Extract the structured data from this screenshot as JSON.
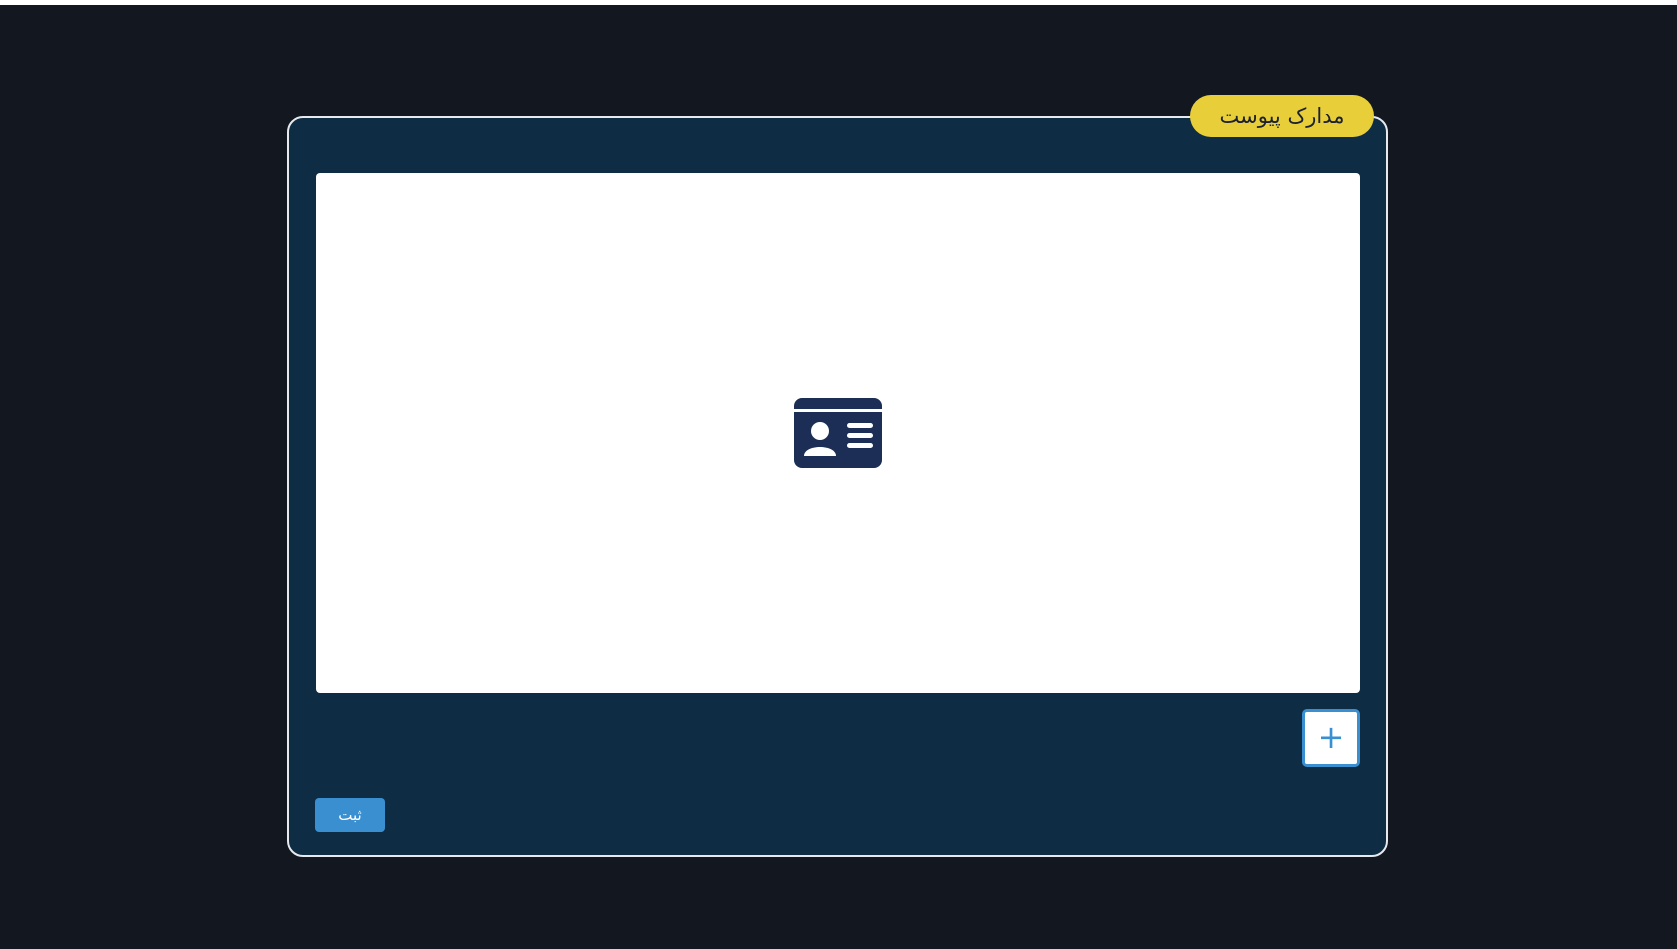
{
  "panel": {
    "title": "مدارک پیوست",
    "preview_icon": "id-card-icon",
    "add_icon": "plus-icon",
    "add_label": "+",
    "submit_label": "ثبت"
  },
  "colors": {
    "background": "#131720",
    "panel": "#0e2c44",
    "accent_yellow": "#e8cf3a",
    "accent_blue": "#3a8fd0",
    "icon_navy": "#1c2e55"
  }
}
